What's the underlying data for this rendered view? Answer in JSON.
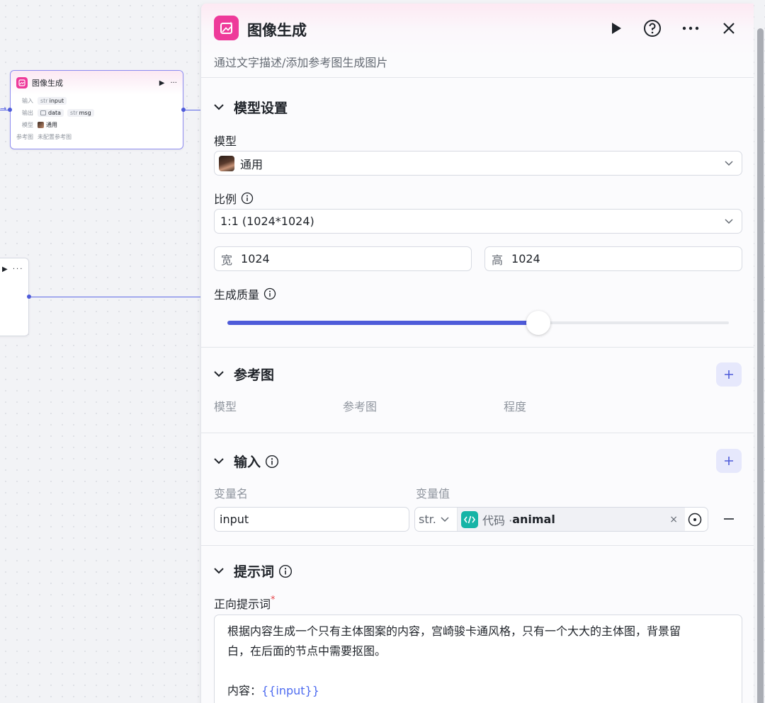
{
  "canvas": {
    "main_node": {
      "title": "图像生成",
      "rows": [
        {
          "label": "输入",
          "tags": [
            {
              "type": "str",
              "name": "input"
            }
          ]
        },
        {
          "label": "输出",
          "tags": [
            {
              "type": "img",
              "name": "data"
            },
            {
              "type": "str",
              "name": "msg"
            }
          ]
        },
        {
          "label": "模型",
          "value": "通用"
        },
        {
          "label": "参考图",
          "value": "未配置参考图"
        }
      ]
    },
    "left_node": {
      "actions": "▶ ···"
    }
  },
  "panel": {
    "title": "图像生成",
    "description": "通过文字描述/添加参考图生成图片",
    "model_settings": {
      "title": "模型设置",
      "model_label": "模型",
      "model_value": "通用",
      "ratio_label": "比例",
      "ratio_value": "1:1 (1024*1024)",
      "width_label": "宽",
      "width_value": "1024",
      "height_label": "高",
      "height_value": "1024",
      "quality_label": "生成质量",
      "quality_fraction": 0.62
    },
    "reference": {
      "title": "参考图",
      "columns": [
        "模型",
        "参考图",
        "程度"
      ]
    },
    "input": {
      "title": "输入",
      "col_name": "变量名",
      "col_value": "变量值",
      "row": {
        "name": "input",
        "type": "str.",
        "ref_prefix": "代码 · ",
        "ref_name": "animal"
      }
    },
    "prompt": {
      "title": "提示词",
      "positive_label": "正向提示词",
      "required_mark": "*",
      "text_line1": "根据内容生成一个只有主体图案的内容，宫崎骏卡通风格，只有一个大大的主体图，背景留",
      "text_line2": "白，在后面的节点中需要抠图。",
      "text_line3_prefix": "内容：",
      "text_line3_var": "{{input}}"
    }
  },
  "colors": {
    "accent": "#4e5bd9",
    "brand_pink": "#ee3a9a",
    "code_teal": "#16b4a6",
    "var_blue": "#4e6cf0"
  }
}
